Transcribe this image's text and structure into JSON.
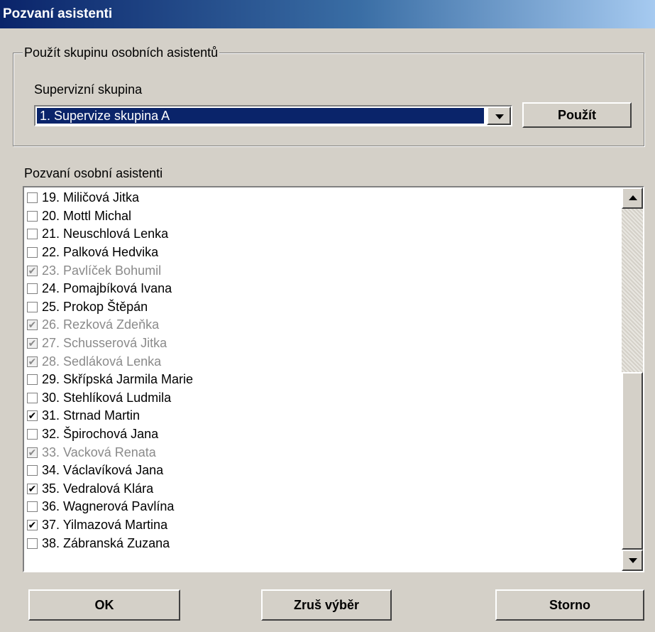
{
  "window": {
    "title": "Pozvaní asistenti"
  },
  "group": {
    "legend": "Použít skupinu osobních asistentů",
    "combo_label": "Supervizní skupina",
    "combo_value": "1. Supervize skupina A",
    "apply_label": "Použít"
  },
  "list": {
    "label": "Pozvaní osobní asistenti",
    "items": [
      {
        "text": "19. Miličová Jitka",
        "checked": false,
        "disabled": false
      },
      {
        "text": "20. Mottl Michal",
        "checked": false,
        "disabled": false
      },
      {
        "text": "21. Neuschlová Lenka",
        "checked": false,
        "disabled": false
      },
      {
        "text": "22. Palková Hedvika",
        "checked": false,
        "disabled": false
      },
      {
        "text": "23. Pavlíček Bohumil",
        "checked": true,
        "disabled": true
      },
      {
        "text": "24. Pomajbíková Ivana",
        "checked": false,
        "disabled": false
      },
      {
        "text": "25. Prokop Štěpán",
        "checked": false,
        "disabled": false
      },
      {
        "text": "26. Rezková Zdeňka",
        "checked": true,
        "disabled": true
      },
      {
        "text": "27. Schusserová Jitka",
        "checked": true,
        "disabled": true
      },
      {
        "text": "28. Sedláková Lenka",
        "checked": true,
        "disabled": true
      },
      {
        "text": "29. Skřípská Jarmila Marie",
        "checked": false,
        "disabled": false
      },
      {
        "text": "30. Stehlíková Ludmila",
        "checked": false,
        "disabled": false
      },
      {
        "text": "31. Strnad Martin",
        "checked": true,
        "disabled": false
      },
      {
        "text": "32. Špirochová Jana",
        "checked": false,
        "disabled": false
      },
      {
        "text": "33. Vacková Renata",
        "checked": true,
        "disabled": true
      },
      {
        "text": "34. Václavíková Jana",
        "checked": false,
        "disabled": false
      },
      {
        "text": "35. Vedralová Klára",
        "checked": true,
        "disabled": false
      },
      {
        "text": "36. Wagnerová Pavlína",
        "checked": false,
        "disabled": false
      },
      {
        "text": "37. Yilmazová Martina",
        "checked": true,
        "disabled": false
      },
      {
        "text": "38. Zábranská Zuzana",
        "checked": false,
        "disabled": false
      }
    ]
  },
  "buttons": {
    "ok": "OK",
    "clear": "Zruš výběr",
    "cancel": "Storno"
  },
  "check_glyph": "✔",
  "colors": {
    "title_start": "#0a246a",
    "title_end": "#a6caf0",
    "selection": "#0a246a",
    "face": "#d4d0c8",
    "disabled_text": "#8a8a8a"
  }
}
